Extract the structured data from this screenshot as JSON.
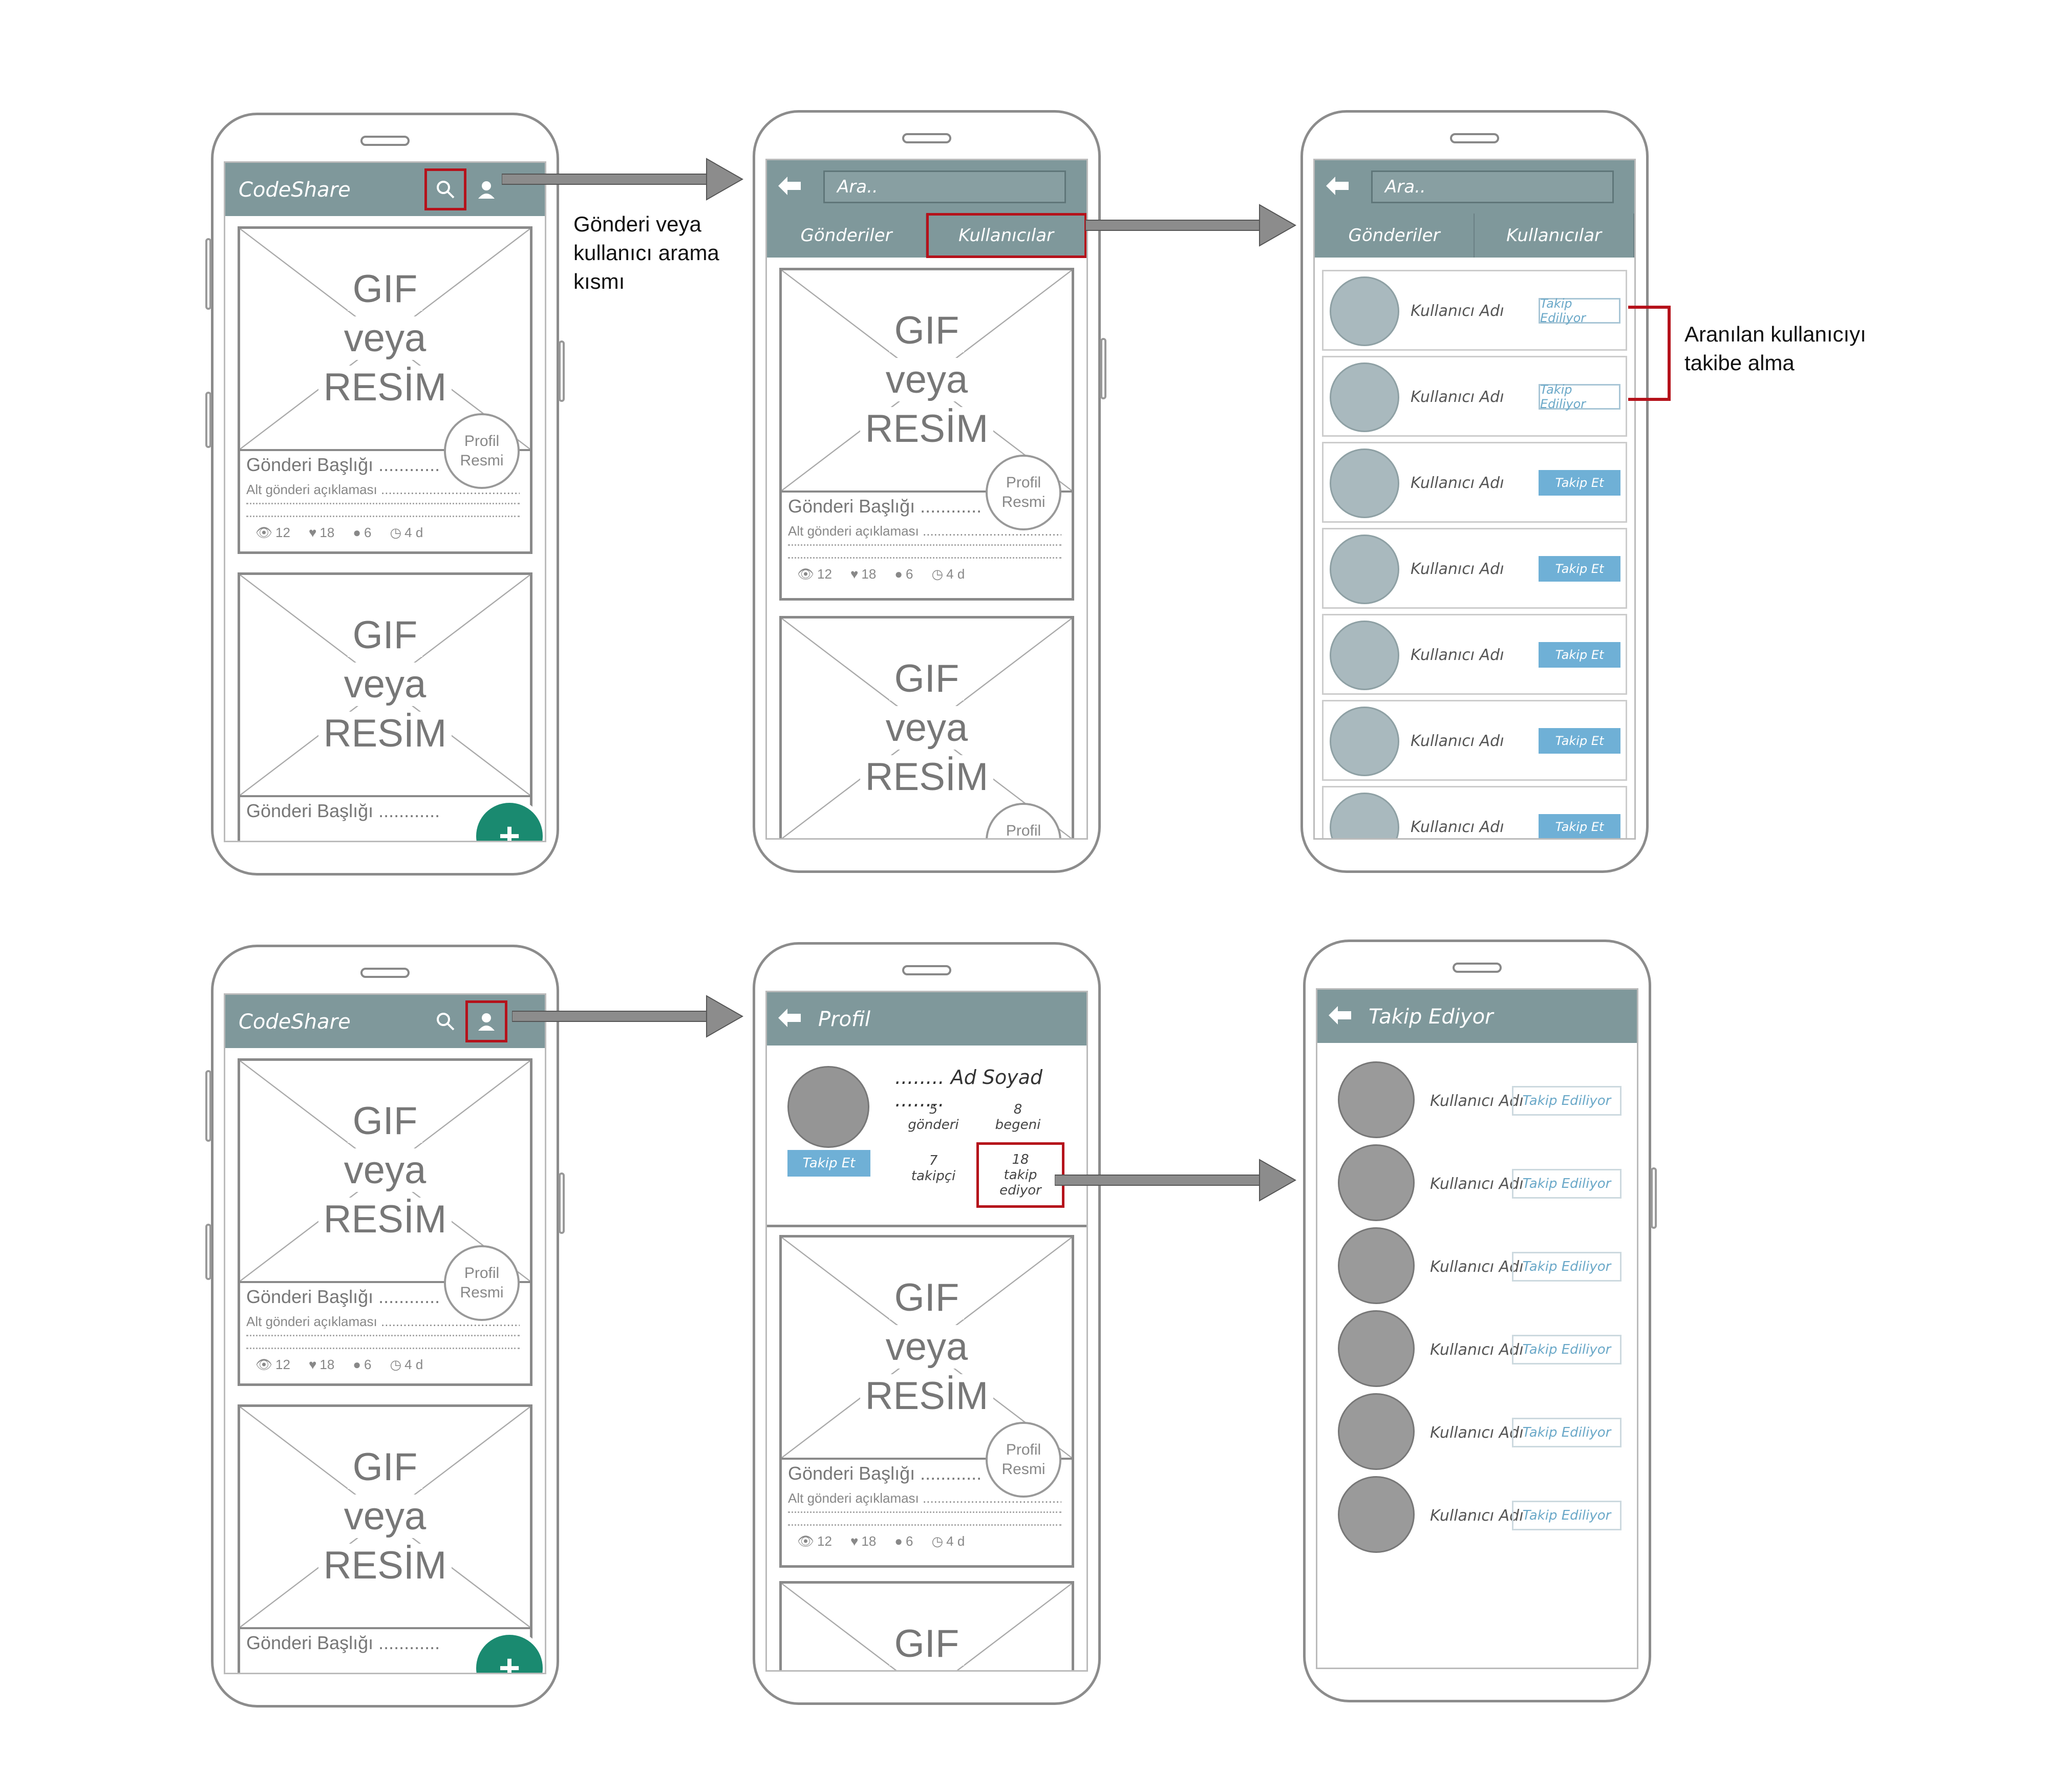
{
  "app": {
    "name": "CodeShare"
  },
  "colors": {
    "appbar": "#7f989b",
    "fab": "#1a8a70",
    "highlight": "#b5121b",
    "follow_active": "#6fb0d6"
  },
  "post": {
    "media_line1": "GIF",
    "media_line2": "veya",
    "media_line3": "RESİM",
    "avatar_line1": "Profil",
    "avatar_line2": "Resmi",
    "title": "Gönderi Başlığı ............",
    "description": "Alt gönderi açıklaması ...........................................",
    "views": "12",
    "likes": "18",
    "comments": "6",
    "age": "4 d"
  },
  "fab": {
    "label": "+"
  },
  "search": {
    "placeholder": "Ara..",
    "tab_posts": "Gönderiler",
    "tab_users": "Kullanıcılar"
  },
  "users": [
    {
      "name": "Kullanıcı Adı",
      "button": "Takip Ediliyor",
      "state": "on"
    },
    {
      "name": "Kullanıcı Adı",
      "button": "Takip Ediliyor",
      "state": "on"
    },
    {
      "name": "Kullanıcı Adı",
      "button": "Takip Et",
      "state": "off"
    },
    {
      "name": "Kullanıcı Adı",
      "button": "Takip Et",
      "state": "off"
    },
    {
      "name": "Kullanıcı Adı",
      "button": "Takip Et",
      "state": "off"
    },
    {
      "name": "Kullanıcı Adı",
      "button": "Takip Et",
      "state": "off"
    },
    {
      "name": "Kullanıcı Adı",
      "button": "Takip Et",
      "state": "off"
    }
  ],
  "profile": {
    "title": "Profil",
    "name": "........ Ad Soyad ........",
    "posts_count": "5",
    "posts_label": "gönderi",
    "likes_count": "8",
    "likes_label": "begeni",
    "followers_count": "7",
    "followers_label": "takipçi",
    "following_count": "18",
    "following_label": "takip ediyor",
    "follow_button": "Takip Et"
  },
  "following": {
    "title": "Takip Ediyor",
    "items": [
      {
        "name": "Kullanıcı Adı",
        "button": "Takip Ediliyor"
      },
      {
        "name": "Kullanıcı Adı",
        "button": "Takip Ediliyor"
      },
      {
        "name": "Kullanıcı Adı",
        "button": "Takip Ediliyor"
      },
      {
        "name": "Kullanıcı Adı",
        "button": "Takip Ediliyor"
      },
      {
        "name": "Kullanıcı Adı",
        "button": "Takip Ediliyor"
      },
      {
        "name": "Kullanıcı Adı",
        "button": "Takip Ediliyor"
      }
    ]
  },
  "notes": {
    "search_line1": "Gönderi veya",
    "search_line2": "kullanıcı arama",
    "search_line3": "kısmı",
    "follow_line1": "Aranılan kullanıcıyı",
    "follow_line2": "takibe alma"
  }
}
